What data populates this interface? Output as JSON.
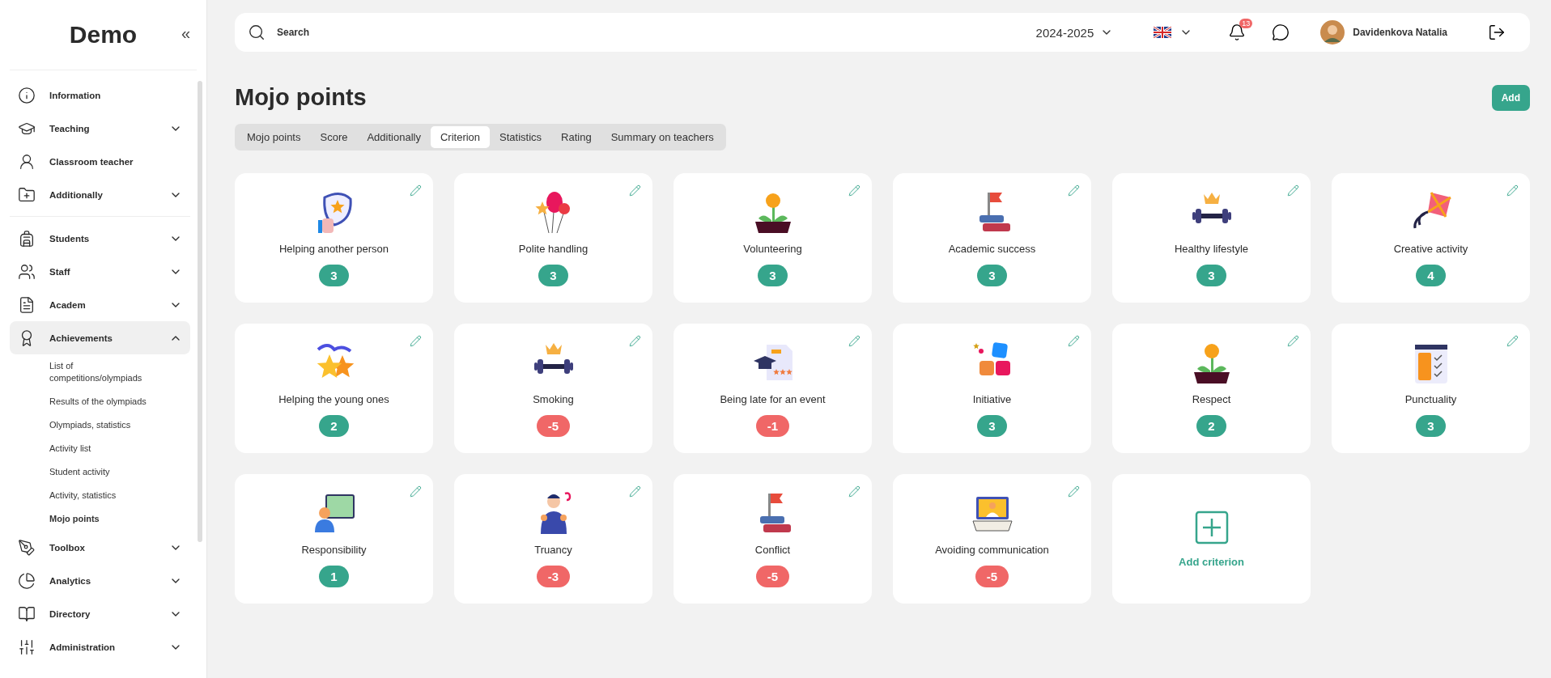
{
  "sidebar": {
    "logo": "Demo",
    "collapse": "«",
    "groups": [
      [
        {
          "label": "Information",
          "selected": false
        },
        {
          "label": "Teaching",
          "expanded": false,
          "selected": false
        },
        {
          "label": "Classroom teacher",
          "selected": false
        },
        {
          "label": "Additionally",
          "expanded": false,
          "selected": false
        }
      ],
      [
        {
          "label": "Students",
          "expanded": false,
          "selected": false
        },
        {
          "label": "Staff",
          "expanded": false,
          "selected": false
        },
        {
          "label": "Academ",
          "expanded": false,
          "selected": false
        },
        {
          "label": "Achievements",
          "expanded": true,
          "selected": true,
          "children": [
            {
              "label": "List of competitions/olympiads",
              "selected": false
            },
            {
              "label": "Results of the olympiads",
              "selected": false
            },
            {
              "label": "Olympiads, statistics",
              "selected": false
            },
            {
              "label": "Activity list",
              "selected": false
            },
            {
              "label": "Student activity",
              "selected": false
            },
            {
              "label": "Activity, statistics",
              "selected": false
            },
            {
              "label": "Mojo points",
              "selected": true
            }
          ]
        },
        {
          "label": "Toolbox",
          "expanded": false,
          "selected": false
        },
        {
          "label": "Analytics",
          "expanded": false,
          "selected": false
        },
        {
          "label": "Directory",
          "expanded": false,
          "selected": false
        },
        {
          "label": "Administration",
          "expanded": false,
          "selected": false
        }
      ]
    ]
  },
  "header": {
    "search": {
      "placeholder": "Search"
    },
    "year": "2024-2025",
    "notifications": "13",
    "user": "Davidenkova Natalia"
  },
  "page": {
    "title": "Mojo points",
    "add_button": "Add"
  },
  "tabs": [
    {
      "label": "Mojo points",
      "selected": false
    },
    {
      "label": "Score",
      "selected": false
    },
    {
      "label": "Additionally",
      "selected": false
    },
    {
      "label": "Criterion",
      "selected": true
    },
    {
      "label": "Statistics",
      "selected": false
    },
    {
      "label": "Rating",
      "selected": false
    },
    {
      "label": "Summary on teachers",
      "selected": false
    }
  ],
  "criteria": [
    {
      "name": "Helping another person",
      "points": "3",
      "color": "#36a58c"
    },
    {
      "name": "Polite handling",
      "points": "3",
      "color": "#36a58c"
    },
    {
      "name": "Volunteering",
      "points": "3",
      "color": "#36a58c"
    },
    {
      "name": "Academic success",
      "points": "3",
      "color": "#36a58c"
    },
    {
      "name": "Healthy lifestyle",
      "points": "3",
      "color": "#36a58c"
    },
    {
      "name": "Creative activity",
      "points": "4",
      "color": "#36a58c"
    },
    {
      "name": "Helping the young ones",
      "points": "2",
      "color": "#36a58c"
    },
    {
      "name": "Smoking",
      "points": "-5",
      "color": "#f06767"
    },
    {
      "name": "Being late for an event",
      "points": "-1",
      "color": "#f06767"
    },
    {
      "name": "Initiative",
      "points": "3",
      "color": "#36a58c"
    },
    {
      "name": "Respect",
      "points": "2",
      "color": "#36a58c"
    },
    {
      "name": "Punctuality",
      "points": "3",
      "color": "#36a58c"
    },
    {
      "name": "Responsibility",
      "points": "1",
      "color": "#36a58c"
    },
    {
      "name": "Truancy",
      "points": "-3",
      "color": "#f06767"
    },
    {
      "name": "Conflict",
      "points": "-5",
      "color": "#f06767"
    },
    {
      "name": "Avoiding communication",
      "points": "-5",
      "color": "#f06767"
    }
  ],
  "add_card": {
    "label": "Add criterion"
  }
}
